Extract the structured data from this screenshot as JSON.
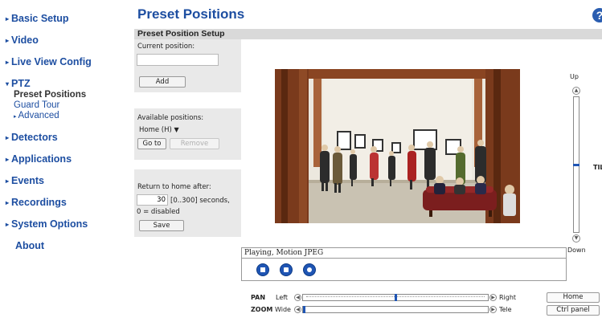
{
  "sidebar": {
    "items": [
      {
        "label": "Basic Setup"
      },
      {
        "label": "Video"
      },
      {
        "label": "Live View Config"
      },
      {
        "label": "PTZ"
      },
      {
        "label": "Detectors"
      },
      {
        "label": "Applications"
      },
      {
        "label": "Events"
      },
      {
        "label": "Recordings"
      },
      {
        "label": "System Options"
      },
      {
        "label": "About"
      }
    ],
    "ptz_sub": {
      "preset": "Preset Positions",
      "guard": "Guard Tour",
      "advanced": "Advanced"
    }
  },
  "header": {
    "title": "Preset Positions",
    "help": "?"
  },
  "section": {
    "title": "Preset Position Setup"
  },
  "current": {
    "label": "Current position:",
    "value": "",
    "add_label": "Add"
  },
  "available": {
    "label": "Available positions:",
    "selected": "Home (H)",
    "goto_label": "Go to",
    "remove_label": "Remove"
  },
  "return_home": {
    "label": "Return to home after:",
    "value": "30",
    "range": "[0..300] seconds,",
    "note": "0 = disabled",
    "save_label": "Save"
  },
  "tilt": {
    "up": "Up",
    "down": "Down",
    "label": "TIL",
    "level": 0.5
  },
  "status": {
    "text": "Playing, Motion JPEG"
  },
  "pan": {
    "label": "PAN",
    "left": "Left",
    "right": "Right",
    "level": 0.5
  },
  "zoom": {
    "label": "ZOOM",
    "wide": "Wide",
    "tele": "Tele",
    "level": 0.0
  },
  "right_buttons": {
    "home": "Home",
    "ctrl": "Ctrl panel"
  },
  "colors": {
    "accent": "#1d4ea1",
    "panel": "#e9e9e9",
    "section": "#d9d9d9",
    "slider_marker": "#1f55b4"
  }
}
